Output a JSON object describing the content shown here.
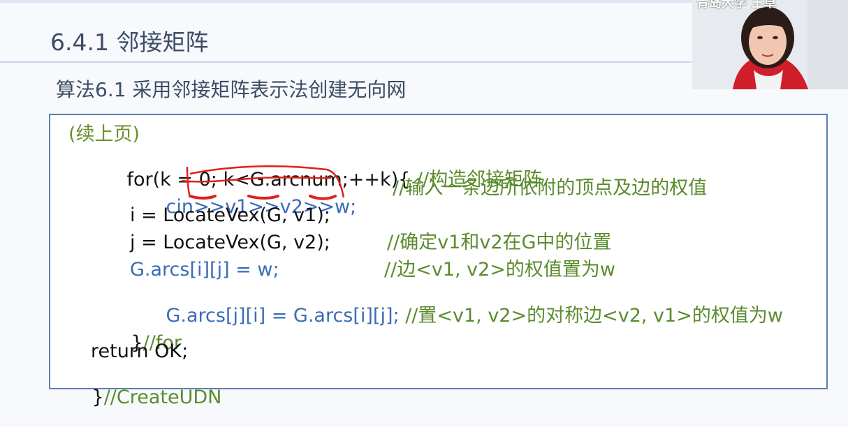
{
  "slide": {
    "title": "6.4.1 邻接矩阵",
    "subtitle": "算法6.1 采用邻接矩阵表示法创建无向网"
  },
  "code": {
    "continuation": "(续上页)",
    "line1_code": "for(k = 0; k<G.arcnum;++k){ ",
    "line1_comment": "//构造邻接矩阵",
    "line2_code": "cin>>v1>>v2>>w;",
    "line2_comment": "//输入一条边所依附的顶点及边的权值",
    "line3_code": "i = LocateVex(G, v1);",
    "line4_code": "j = LocateVex(G, v2);",
    "line4_comment": "//确定v1和v2在G中的位置",
    "line5_code": "G.arcs[i][j] = w;",
    "line5_comment": "//边<v1, v2>的权值置为w",
    "line6_code": "G.arcs[j][i] = G.arcs[i][j];",
    "line6_comment": " //置<v1, v2>的对称边<v2, v1>的权值为w",
    "line7_code": "}",
    "line7_comment": "//for",
    "line8_code": "return OK;",
    "line9_code": "}",
    "line9_comment": "//CreateUDN"
  },
  "webcam": {
    "watermark": "青岛大学 王卓"
  },
  "colors": {
    "title": "#3d4c66",
    "code_black": "#111111",
    "code_blue": "#3a6cb3",
    "comment_green": "#5b8b2d",
    "box_border": "#5e7fb1",
    "annotation_red": "#e0201b"
  }
}
